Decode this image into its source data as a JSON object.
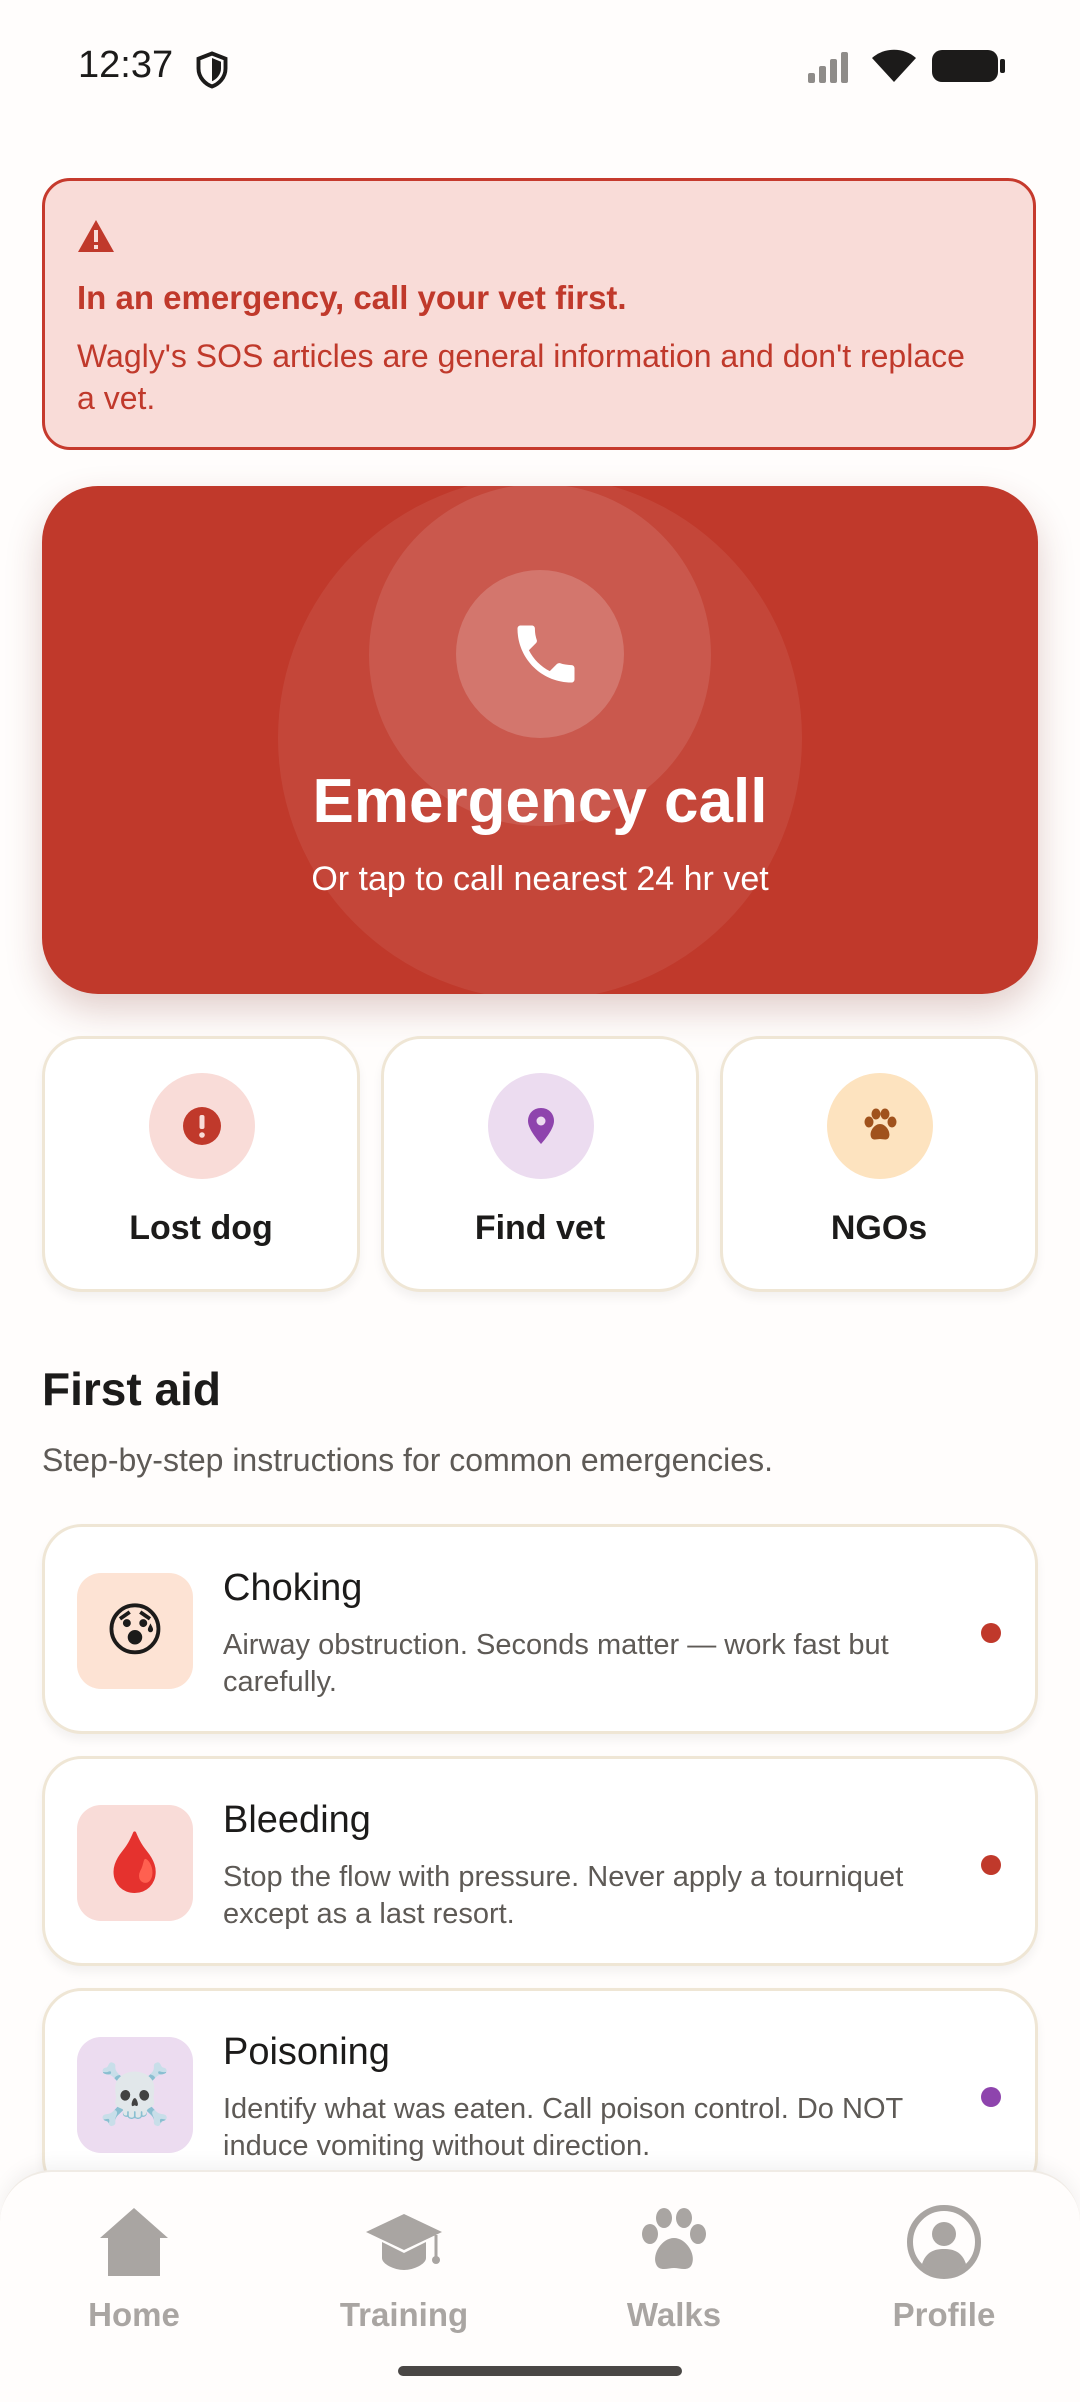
{
  "status": {
    "time": "12:37",
    "icons": [
      "shield-icon",
      "signal-icon",
      "wifi-icon",
      "battery-icon"
    ]
  },
  "alert": {
    "icon": "warning-icon",
    "title": "In an emergency, call your vet first.",
    "body": "Wagly's SOS articles are general information and don't replace a vet.",
    "color": "#c0392b",
    "background": "#f9dcd8"
  },
  "emergency": {
    "icon": "phone-icon",
    "title": "Emergency call",
    "subtitle": "Or tap to call nearest 24 hr vet",
    "color": "#c0392b"
  },
  "quick_actions": [
    {
      "label": "Lost dog",
      "icon": "exclamation-circle-icon",
      "color": "#c0392b",
      "bg": "#f9dcd8"
    },
    {
      "label": "Find vet",
      "icon": "location-pin-icon",
      "color": "#8e44ad",
      "bg": "#ecdcf0"
    },
    {
      "label": "NGOs",
      "icon": "paw-icon",
      "color": "#a0521c",
      "bg": "#fde3bf"
    }
  ],
  "first_aid": {
    "title": "First aid",
    "subtitle": "Step-by-step instructions for common emergencies.",
    "items": [
      {
        "title": "Choking",
        "description": "Airway obstruction. Seconds matter — work fast but carefully.",
        "emoji": "😰",
        "emoji_bg": "#fde3d4",
        "dot_color": "#c0392b"
      },
      {
        "title": "Bleeding",
        "description": "Stop the flow with pressure. Never apply a tourniquet except as a last resort.",
        "emoji": "🩸",
        "emoji_bg": "#f9dcd8",
        "dot_color": "#c0392b"
      },
      {
        "title": "Poisoning",
        "description": "Identify what was eaten. Call poison control. Do NOT induce vomiting without direction.",
        "emoji": "☠️",
        "emoji_bg": "#ecdcf0",
        "dot_color": "#8e44ad"
      }
    ]
  },
  "nav": {
    "items": [
      {
        "label": "Home",
        "icon": "home-icon"
      },
      {
        "label": "Training",
        "icon": "graduation-cap-icon"
      },
      {
        "label": "Walks",
        "icon": "paw-icon"
      },
      {
        "label": "Profile",
        "icon": "user-icon"
      }
    ]
  }
}
